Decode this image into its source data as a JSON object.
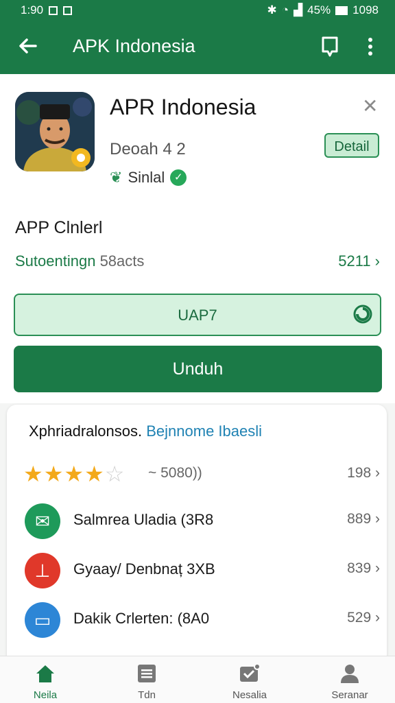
{
  "status_bar": {
    "time": "1:90",
    "battery": "45%",
    "extra": "1098"
  },
  "app_bar": {
    "title": "APK Indonesia"
  },
  "app": {
    "name": "APR Indonesia",
    "developer": "Deoah 4 2",
    "tag": "Sinlal",
    "detail_label": "Detail"
  },
  "content": {
    "heading": "APP Clnlerl",
    "subtitle_green": "Sutoentingn",
    "subtitle_gray": "58acts",
    "count": "5211 ›",
    "chip_label": "UAP7",
    "download_label": "Unduh"
  },
  "card": {
    "title_black": "Xphriadralonsos.",
    "title_blue": "Bejnnome Ibaesli",
    "rating": {
      "value_text": "~ 5080))",
      "count": "198 ›",
      "stars": 4,
      "max_stars": 5
    },
    "rows": [
      {
        "label": "Salmrea Uladia  (3R8",
        "value": "889 ›",
        "icon": "mail-icon",
        "color": "#1e9a5a"
      },
      {
        "label": "Gyaay/ Denbnaț 3XB",
        "value": "839 ›",
        "icon": "stamp-icon",
        "color": "#e0382a"
      },
      {
        "label": "Dakik Crlerten: (8A0",
        "value": "529 ›",
        "icon": "message-icon",
        "color": "#2d86d6"
      }
    ]
  },
  "bottom_nav": [
    {
      "label": "Neila",
      "icon": "home-icon",
      "active": true
    },
    {
      "label": "Tdn",
      "icon": "list-icon",
      "active": false
    },
    {
      "label": "Nesalia",
      "icon": "mail-notify-icon",
      "active": false
    },
    {
      "label": "Seranar",
      "icon": "profile-icon",
      "active": false
    }
  ]
}
